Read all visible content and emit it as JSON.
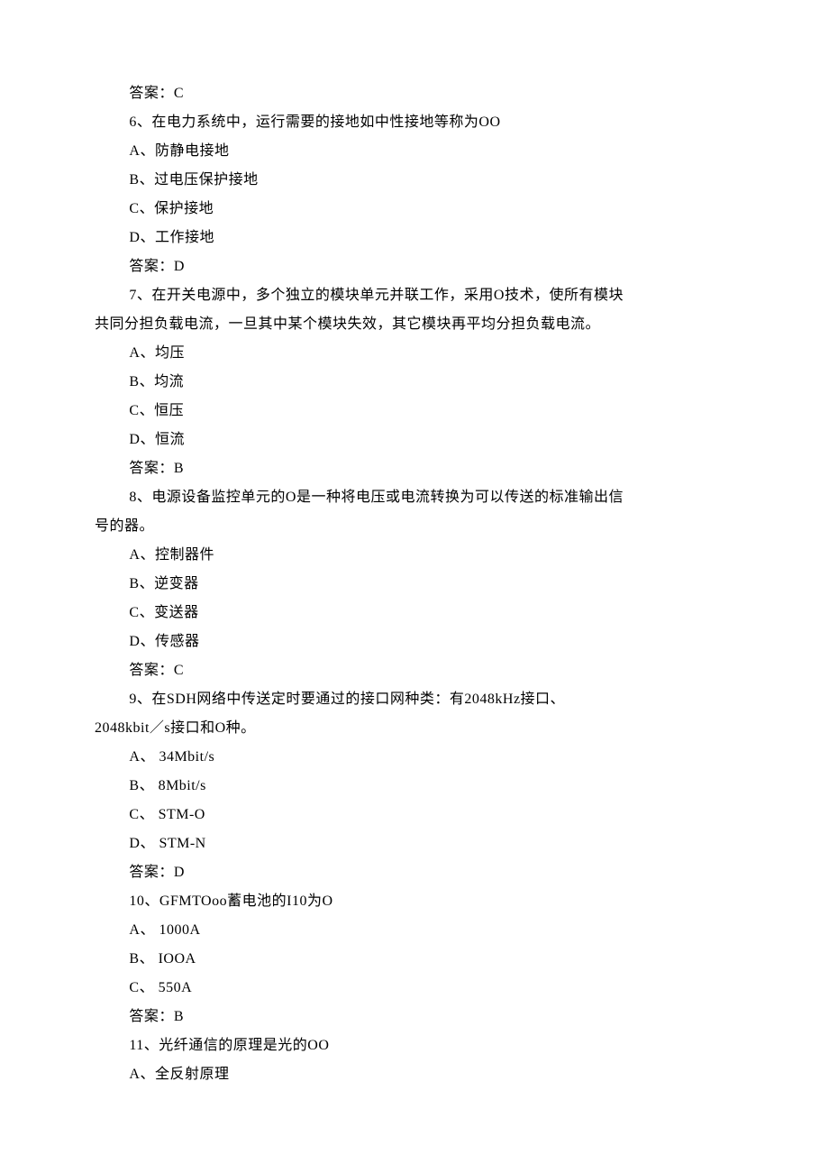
{
  "lines": [
    {
      "text": "答案：C",
      "indent": true
    },
    {
      "text": "6、在电力系统中，运行需要的接地如中性接地等称为OO",
      "indent": true
    },
    {
      "text": "A、防静电接地",
      "indent": true
    },
    {
      "text": "B、过电压保护接地",
      "indent": true
    },
    {
      "text": "C、保护接地",
      "indent": true
    },
    {
      "text": "D、工作接地",
      "indent": true
    },
    {
      "text": "答案：D",
      "indent": true
    },
    {
      "text": "7、在开关电源中，多个独立的模块单元并联工作，采用O技术，使所有模块",
      "indent": true
    },
    {
      "text": "共同分担负载电流，一旦其中某个模块失效，其它模块再平均分担负载电流。",
      "indent": false
    },
    {
      "text": "A、均压",
      "indent": true
    },
    {
      "text": "B、均流",
      "indent": true
    },
    {
      "text": "C、恒压",
      "indent": true
    },
    {
      "text": "D、恒流",
      "indent": true
    },
    {
      "text": "答案：B",
      "indent": true
    },
    {
      "text": "8、电源设备监控单元的O是一种将电压或电流转换为可以传送的标准输出信",
      "indent": true
    },
    {
      "text": "号的器。",
      "indent": false
    },
    {
      "text": "A、控制器件",
      "indent": true
    },
    {
      "text": "B、逆变器",
      "indent": true
    },
    {
      "text": "C、变送器",
      "indent": true
    },
    {
      "text": "D、传感器",
      "indent": true
    },
    {
      "text": "答案：C",
      "indent": true
    },
    {
      "text": "9、在SDH网络中传送定时要通过的接口网种类：有2048kHz接口、",
      "indent": true
    },
    {
      "text": "2048kbit／s接口和O种。",
      "indent": false
    },
    {
      "text": "A、 34Mbit/s",
      "indent": true
    },
    {
      "text": "B、 8Mbit/s",
      "indent": true
    },
    {
      "text": "C、 STM-O",
      "indent": true
    },
    {
      "text": "D、 STM-N",
      "indent": true
    },
    {
      "text": "答案：D",
      "indent": true
    },
    {
      "text": "10、GFMTOoo蓄电池的I10为O",
      "indent": true
    },
    {
      "text": "A、 1000A",
      "indent": true
    },
    {
      "text": "B、 IOOA",
      "indent": true
    },
    {
      "text": "C、 550A",
      "indent": true
    },
    {
      "text": "答案：B",
      "indent": true
    },
    {
      "text": "11、光纤通信的原理是光的OO",
      "indent": true
    },
    {
      "text": "A、全反射原理",
      "indent": true
    }
  ]
}
